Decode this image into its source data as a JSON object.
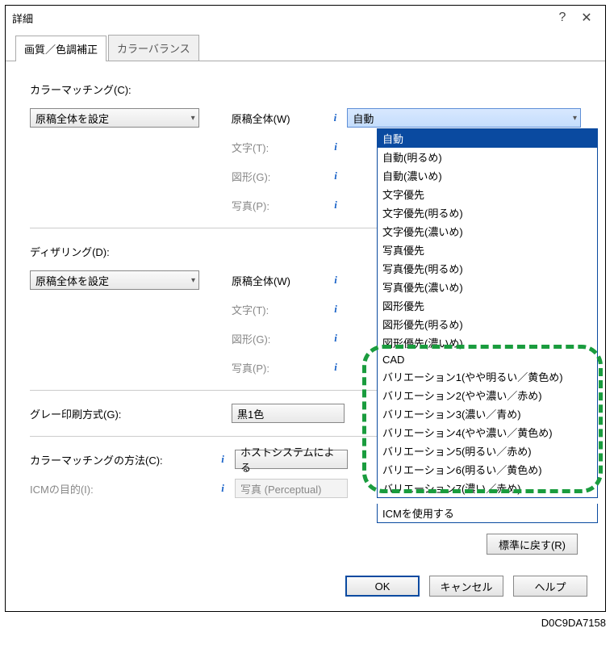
{
  "dialog": {
    "title": "詳細",
    "help_icon": "?",
    "close_icon": "✕"
  },
  "tabs": {
    "active": "画質／色調補正",
    "inactive": "カラーバランス"
  },
  "sections": {
    "color_matching_label": "カラーマッチング(C):",
    "color_matching_value": "原稿全体を設定",
    "dithering_label": "ディザリング(D):",
    "dithering_value": "原稿全体を設定",
    "gray_print_label": "グレー印刷方式(G):",
    "gray_print_value": "黒1色",
    "cm_method_label": "カラーマッチングの方法(C):",
    "cm_method_value": "ホストシステムによる",
    "icm_label": "ICMの目的(I):",
    "icm_value": "写真 (Perceptual)"
  },
  "right_labels": {
    "whole_w": "原稿全体(W)",
    "text_t": "文字(T):",
    "graphic_g": "図形(G):",
    "photo_p": "写真(P):"
  },
  "dropdown": {
    "selected": "自動",
    "options": [
      "自動",
      "自動(明るめ)",
      "自動(濃いめ)",
      "文字優先",
      "文字優先(明るめ)",
      "文字優先(濃いめ)",
      "写真優先",
      "写真優先(明るめ)",
      "写真優先(濃いめ)",
      "図形優先",
      "図形優先(明るめ)",
      "図形優先(濃いめ)",
      "CAD",
      "バリエーション1(やや明るい／黄色め)",
      "バリエーション2(やや濃い／赤め)",
      "バリエーション3(濃い／青め)",
      "バリエーション4(やや濃い／黄色め)",
      "バリエーション5(明るい／赤め)",
      "バリエーション6(明るい／黄色め)",
      "バリエーション7(濃い／赤め)"
    ],
    "tail": "ICMを使用する"
  },
  "buttons": {
    "reset": "標準に戻す(R)",
    "ok": "OK",
    "cancel": "キャンセル",
    "help": "ヘルプ"
  },
  "image_id": "D0C9DA7158"
}
